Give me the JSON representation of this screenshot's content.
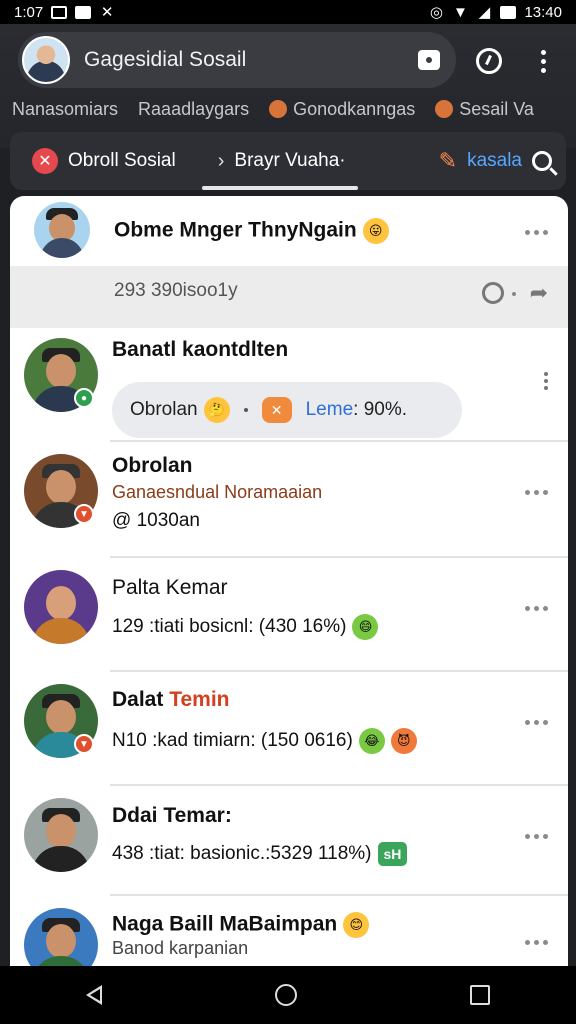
{
  "status_bar": {
    "time_left": "1:07",
    "time_right": "13:40"
  },
  "header": {
    "title": "Gagesidial Sosail"
  },
  "categories": [
    {
      "label": "Nanasomiars",
      "icon": ""
    },
    {
      "label": "Raaadlaygars",
      "icon": ""
    },
    {
      "label": "Gonodkanngas",
      "icon": "orange-dot"
    },
    {
      "label": "Sesail Va",
      "icon": "orange-dot"
    }
  ],
  "tabs": [
    {
      "label": "Obroll Sosial"
    },
    {
      "label": "Brayr Vuaha·"
    },
    {
      "label": "kasala"
    }
  ],
  "feed": {
    "post": {
      "name": "Obme Mnger ThnyNgain",
      "stats": "293 390isoo1y"
    },
    "items": [
      {
        "name": "Banatl kaontdlten",
        "chip_left": "Obrolan",
        "chip_right": "Leme",
        "chip_value": ": 90%."
      },
      {
        "name": "Obrolan",
        "sub": "Ganaesndual Noramaaian",
        "line": "@ 1030an"
      },
      {
        "name": "Palta Kemar",
        "line": "129 :tiati bosicnl: (430 16%)"
      },
      {
        "name": "Dalat",
        "name_accent": "Temin",
        "line": "N10 :kad timiarn: (150 0616)"
      },
      {
        "name": "Ddai Temar:",
        "line": "438 :tiat: basionic.:5329 118%)",
        "badge": "sH"
      },
      {
        "name": "Naga Baill MaBaimpan",
        "sub": "Banod karpanian"
      }
    ]
  },
  "colors": {
    "accent_orange": "#f0793a",
    "accent_blue": "#58a6ff",
    "card_bg": "#ffffff",
    "app_bg": "#24262b"
  }
}
